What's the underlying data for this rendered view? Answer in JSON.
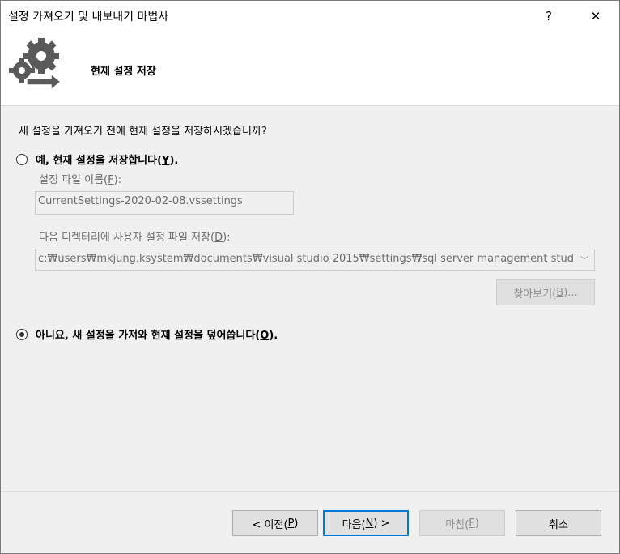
{
  "window": {
    "title": "설정 가져오기 및 내보내기 마법사",
    "help_glyph": "?",
    "close_glyph": "✕"
  },
  "header": {
    "title": "현재 설정 저장",
    "icon": "gears-arrow-icon"
  },
  "content": {
    "question": "새 설정을 가져오기 전에 현재 설정을 저장하시겠습니까?",
    "option_save": {
      "label_prefix": "예, 현재 설정을 저장합니다(",
      "mnemonic": "Y",
      "label_suffix": ").",
      "selected": false
    },
    "file_name_label": {
      "prefix": "설정 파일 이름(",
      "mnemonic": "F",
      "suffix": "):"
    },
    "file_name_value": "CurrentSettings-2020-02-08.vssettings",
    "directory_label": {
      "prefix": "다음 디렉터리에 사용자 설정 파일 저장(",
      "mnemonic": "D",
      "suffix": "):"
    },
    "directory_value": "c:₩users₩mkjung.ksystem₩documents₩visual studio 2015₩settings₩sql server management stud",
    "browse_button": {
      "prefix": "찾아보기(",
      "mnemonic": "B",
      "suffix": ")..."
    },
    "option_overwrite": {
      "label_prefix": "아니요, 새 설정을 가져와 현재 설정을 덮어씁니다(",
      "mnemonic": "O",
      "label_suffix": ").",
      "selected": true
    }
  },
  "footer": {
    "back": {
      "prefix": "< 이전(",
      "mnemonic": "P",
      "suffix": ")"
    },
    "next": {
      "prefix": "다음(",
      "mnemonic": "N",
      "suffix": ") >"
    },
    "finish": {
      "prefix": "마침(",
      "mnemonic": "F",
      "suffix": ")"
    },
    "cancel": "취소"
  },
  "colors": {
    "accent": "#0078d7",
    "icon_gray": "#5a5a5a"
  }
}
